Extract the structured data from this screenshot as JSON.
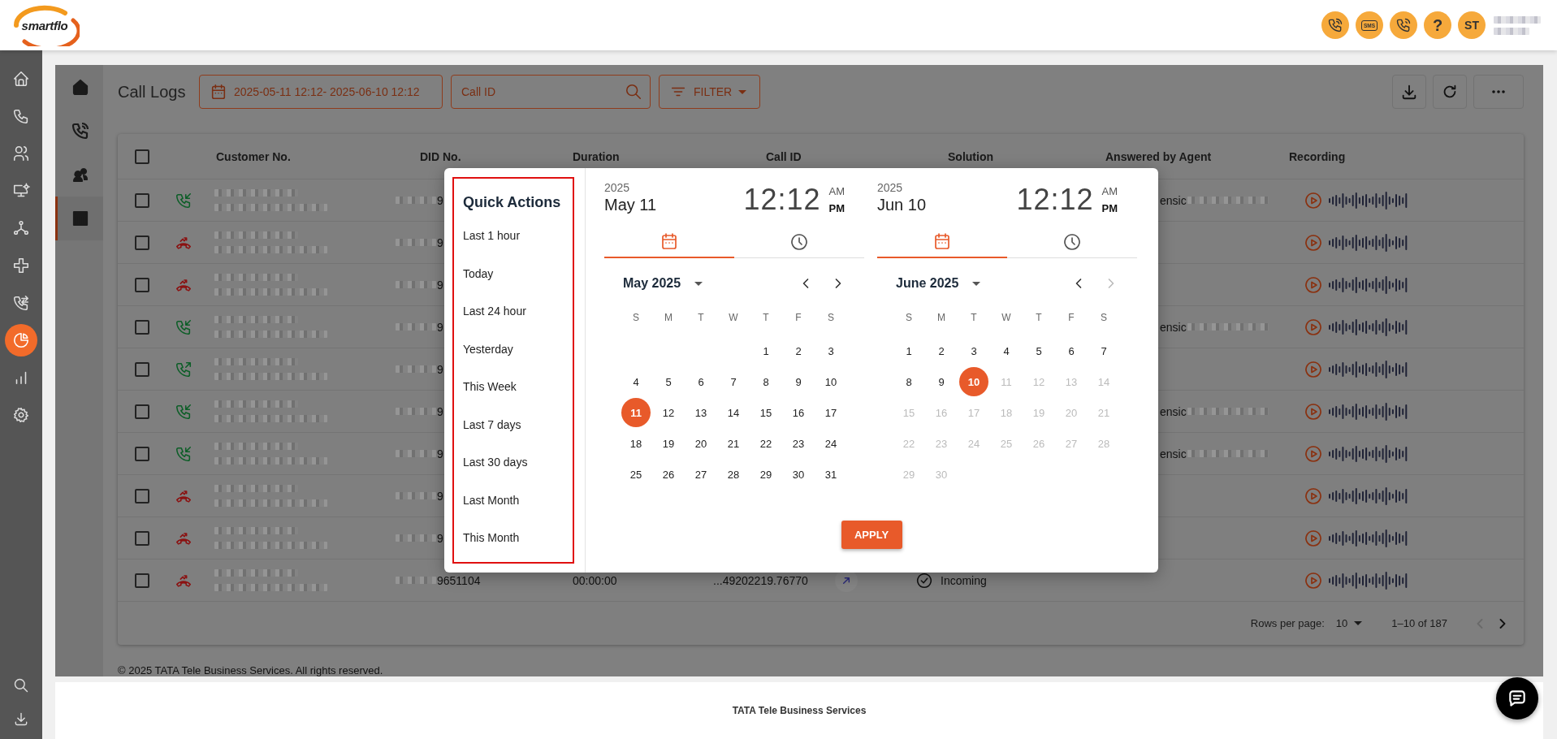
{
  "header": {
    "logo_text": "smartflo",
    "sms_label": "SMS",
    "help_glyph": "?",
    "avatar_initials": "ST"
  },
  "sidebar": {
    "items": [
      {
        "selected": false
      },
      {
        "selected": false
      },
      {
        "selected": false
      },
      {
        "selected": false
      },
      {
        "selected": false
      },
      {
        "selected": false
      },
      {
        "selected": false
      },
      {
        "selected": true
      },
      {
        "selected": false
      },
      {
        "selected": false
      }
    ]
  },
  "subnav": {
    "items": [
      {
        "selected": false
      },
      {
        "selected": false
      },
      {
        "selected": false
      },
      {
        "selected": true
      }
    ]
  },
  "page": {
    "title": "Call Logs",
    "date_range": "2025-05-11 12:12- 2025-06-10 12:12",
    "search": {
      "placeholder": "Call ID"
    },
    "filter_label": "FILTER"
  },
  "table": {
    "select_all": {
      "checked": false
    },
    "columns": [
      "Customer No.",
      "DID No.",
      "Duration",
      "Call ID",
      "Solution",
      "Answered by Agent",
      "Recording"
    ],
    "rows": [
      {
        "kind": "incoming",
        "checked": false,
        "did": "9",
        "agent": "ensic"
      },
      {
        "kind": "missed",
        "checked": false,
        "did": "9"
      },
      {
        "kind": "missed",
        "checked": false,
        "did": "9"
      },
      {
        "kind": "incoming",
        "checked": false,
        "did": "9",
        "agent": "ensic"
      },
      {
        "kind": "outgoing",
        "checked": false,
        "did": "9"
      },
      {
        "kind": "incoming",
        "checked": false,
        "did": "9",
        "agent": "ensic"
      },
      {
        "kind": "incoming",
        "checked": false,
        "did": "9",
        "agent": "ensic"
      },
      {
        "kind": "missed",
        "checked": false,
        "did": "9"
      },
      {
        "kind": "missed",
        "checked": false,
        "did": "9"
      },
      {
        "kind": "missed",
        "checked": false,
        "did": "9651104",
        "duration": "00:00:00",
        "call_id": "...49202219.76770",
        "solution": "Incoming"
      }
    ],
    "pagination": {
      "rows_per_page_label": "Rows per page:",
      "rows_per_page": "10",
      "range": "1–10 of 187"
    }
  },
  "footer": {
    "copyright": "© 2025 TATA Tele Business Services. All rights reserved.",
    "company": "TATA Tele Business Services"
  },
  "date_picker": {
    "quick_actions": {
      "title": "Quick Actions",
      "items": [
        "Last 1 hour",
        "Today",
        "Last 24 hour",
        "Yesterday",
        "This Week",
        "Last 7 days",
        "Last 30 days",
        "Last Month",
        "This Month"
      ]
    },
    "apply_label": "APPLY",
    "calendars": [
      {
        "year": "2025",
        "date": "May 11",
        "time": "12:12",
        "meridiem": [
          {
            "label": "AM",
            "selected": false
          },
          {
            "label": "PM",
            "selected": true
          }
        ],
        "tabs": [
          {
            "selected": true
          },
          {
            "selected": false
          }
        ],
        "month_label": "May 2025",
        "nav": [
          {
            "disabled": false
          },
          {
            "disabled": false
          }
        ],
        "weekdays": [
          "S",
          "M",
          "T",
          "W",
          "T",
          "F",
          "S"
        ],
        "weeks": [
          [
            {
              "day": "1",
              "selected": false,
              "disabled": false
            },
            {
              "day": "2",
              "selected": false,
              "disabled": false
            },
            {
              "day": "3",
              "selected": false,
              "disabled": false
            }
          ],
          [
            {
              "day": "4",
              "selected": false,
              "disabled": false
            },
            {
              "day": "5",
              "selected": false,
              "disabled": false
            },
            {
              "day": "6",
              "selected": false,
              "disabled": false
            },
            {
              "day": "7",
              "selected": false,
              "disabled": false
            },
            {
              "day": "8",
              "selected": false,
              "disabled": false
            },
            {
              "day": "9",
              "selected": false,
              "disabled": false
            },
            {
              "day": "10",
              "selected": false,
              "disabled": false
            }
          ],
          [
            {
              "day": "11",
              "selected": true,
              "disabled": false
            },
            {
              "day": "12",
              "selected": false,
              "disabled": false
            },
            {
              "day": "13",
              "selected": false,
              "disabled": false
            },
            {
              "day": "14",
              "selected": false,
              "disabled": false
            },
            {
              "day": "15",
              "selected": false,
              "disabled": false
            },
            {
              "day": "16",
              "selected": false,
              "disabled": false
            },
            {
              "day": "17",
              "selected": false,
              "disabled": false
            }
          ],
          [
            {
              "day": "18",
              "selected": false,
              "disabled": false
            },
            {
              "day": "19",
              "selected": false,
              "disabled": false
            },
            {
              "day": "20",
              "selected": false,
              "disabled": false
            },
            {
              "day": "21",
              "selected": false,
              "disabled": false
            },
            {
              "day": "22",
              "selected": false,
              "disabled": false
            },
            {
              "day": "23",
              "selected": false,
              "disabled": false
            },
            {
              "day": "24",
              "selected": false,
              "disabled": false
            }
          ],
          [
            {
              "day": "25",
              "selected": false,
              "disabled": false
            },
            {
              "day": "26",
              "selected": false,
              "disabled": false
            },
            {
              "day": "27",
              "selected": false,
              "disabled": false
            },
            {
              "day": "28",
              "selected": false,
              "disabled": false
            },
            {
              "day": "29",
              "selected": false,
              "disabled": false
            },
            {
              "day": "30",
              "selected": false,
              "disabled": false
            },
            {
              "day": "31",
              "selected": false,
              "disabled": false
            }
          ]
        ]
      },
      {
        "year": "2025",
        "date": "Jun 10",
        "time": "12:12",
        "meridiem": [
          {
            "label": "AM",
            "selected": false
          },
          {
            "label": "PM",
            "selected": true
          }
        ],
        "tabs": [
          {
            "selected": true
          },
          {
            "selected": false
          }
        ],
        "month_label": "June 2025",
        "nav": [
          {
            "disabled": false
          },
          {
            "disabled": true
          }
        ],
        "weekdays": [
          "S",
          "M",
          "T",
          "W",
          "T",
          "F",
          "S"
        ],
        "weeks": [
          [
            {
              "day": "1",
              "selected": false,
              "disabled": false
            },
            {
              "day": "2",
              "selected": false,
              "disabled": false
            },
            {
              "day": "3",
              "selected": false,
              "disabled": false
            },
            {
              "day": "4",
              "selected": false,
              "disabled": false
            },
            {
              "day": "5",
              "selected": false,
              "disabled": false
            },
            {
              "day": "6",
              "selected": false,
              "disabled": false
            },
            {
              "day": "7",
              "selected": false,
              "disabled": false
            }
          ],
          [
            {
              "day": "8",
              "selected": false,
              "disabled": false
            },
            {
              "day": "9",
              "selected": false,
              "disabled": false
            },
            {
              "day": "10",
              "selected": true,
              "disabled": false
            },
            {
              "day": "11",
              "selected": false,
              "disabled": true
            },
            {
              "day": "12",
              "selected": false,
              "disabled": true
            },
            {
              "day": "13",
              "selected": false,
              "disabled": true
            },
            {
              "day": "14",
              "selected": false,
              "disabled": true
            }
          ],
          [
            {
              "day": "15",
              "selected": false,
              "disabled": true
            },
            {
              "day": "16",
              "selected": false,
              "disabled": true
            },
            {
              "day": "17",
              "selected": false,
              "disabled": true
            },
            {
              "day": "18",
              "selected": false,
              "disabled": true
            },
            {
              "day": "19",
              "selected": false,
              "disabled": true
            },
            {
              "day": "20",
              "selected": false,
              "disabled": true
            },
            {
              "day": "21",
              "selected": false,
              "disabled": true
            }
          ],
          [
            {
              "day": "22",
              "selected": false,
              "disabled": true
            },
            {
              "day": "23",
              "selected": false,
              "disabled": true
            },
            {
              "day": "24",
              "selected": false,
              "disabled": true
            },
            {
              "day": "25",
              "selected": false,
              "disabled": true
            },
            {
              "day": "26",
              "selected": false,
              "disabled": true
            },
            {
              "day": "27",
              "selected": false,
              "disabled": true
            },
            {
              "day": "28",
              "selected": false,
              "disabled": true
            }
          ],
          [
            {
              "day": "29",
              "selected": false,
              "disabled": true
            },
            {
              "day": "30",
              "selected": false,
              "disabled": true
            }
          ]
        ]
      }
    ]
  }
}
